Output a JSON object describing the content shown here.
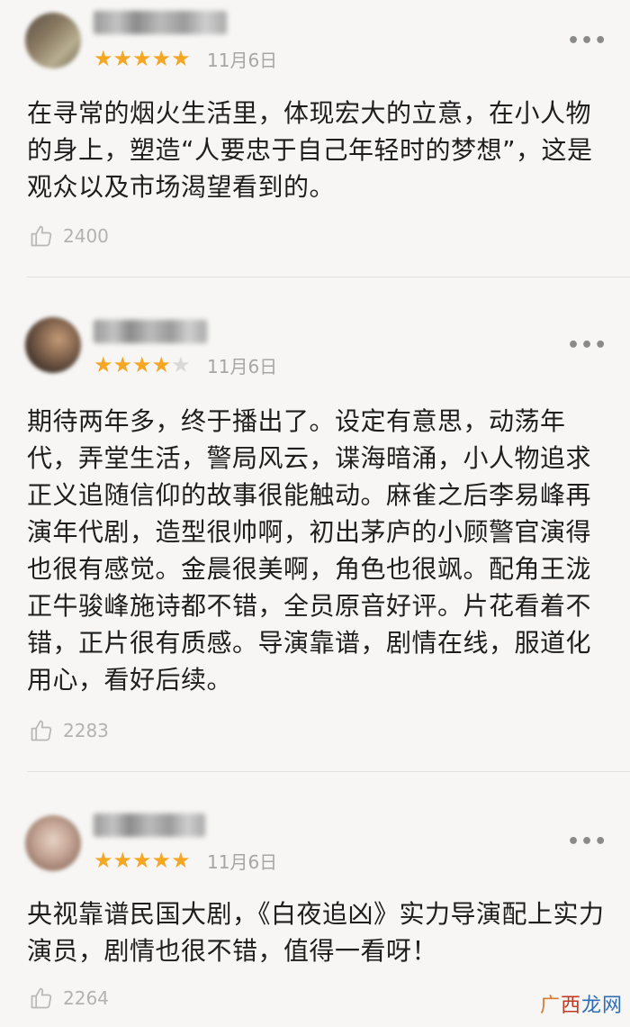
{
  "reviews": [
    {
      "date": "11月6日",
      "stars_filled": 5,
      "stars_total": 5,
      "stars_on": "★★★★★",
      "stars_off": "",
      "more": "•••",
      "content": "在寻常的烟火生活里，体现宏大的立意，在小人物的身上，塑造“人要忠于自己年轻时的梦想”，这是观众以及市场渴望看到的。",
      "likes": "2400"
    },
    {
      "date": "11月6日",
      "stars_filled": 4,
      "stars_total": 5,
      "stars_on": "★★★★",
      "stars_off": "★",
      "more": "•••",
      "content": "期待两年多，终于播出了。设定有意思，动荡年代，弄堂生活，警局风云，谍海暗涌，小人物追求正义追随信仰的故事很能触动。麻雀之后李易峰再演年代剧，造型很帅啊，初出茅庐的小顾警官演得也很有感觉。金晨很美啊，角色也很飒。配角王泷正牛骏峰施诗都不错，全员原音好评。片花看着不错，正片很有质感。导演靠谱，剧情在线，服道化用心，看好后续。",
      "likes": "2283"
    },
    {
      "date": "11月6日",
      "stars_filled": 5,
      "stars_total": 5,
      "stars_on": "★★★★★",
      "stars_off": "",
      "more": "•••",
      "content": "央视靠谱民国大剧，《白夜追凶》实力导演配上实力演员，剧情也很不错，值得一看呀！",
      "likes": "2264"
    }
  ],
  "watermark": {
    "part1": "广",
    "part2": "西",
    "part3": "龙网"
  },
  "icons": {
    "like": "thumbs-up-icon",
    "more": "more-dots-icon"
  },
  "colors": {
    "star": "#f5a623",
    "star_empty": "#d9d9d9",
    "date": "#a6a6a6",
    "like": "#b2b2b2",
    "background": "#f7f6f5"
  }
}
